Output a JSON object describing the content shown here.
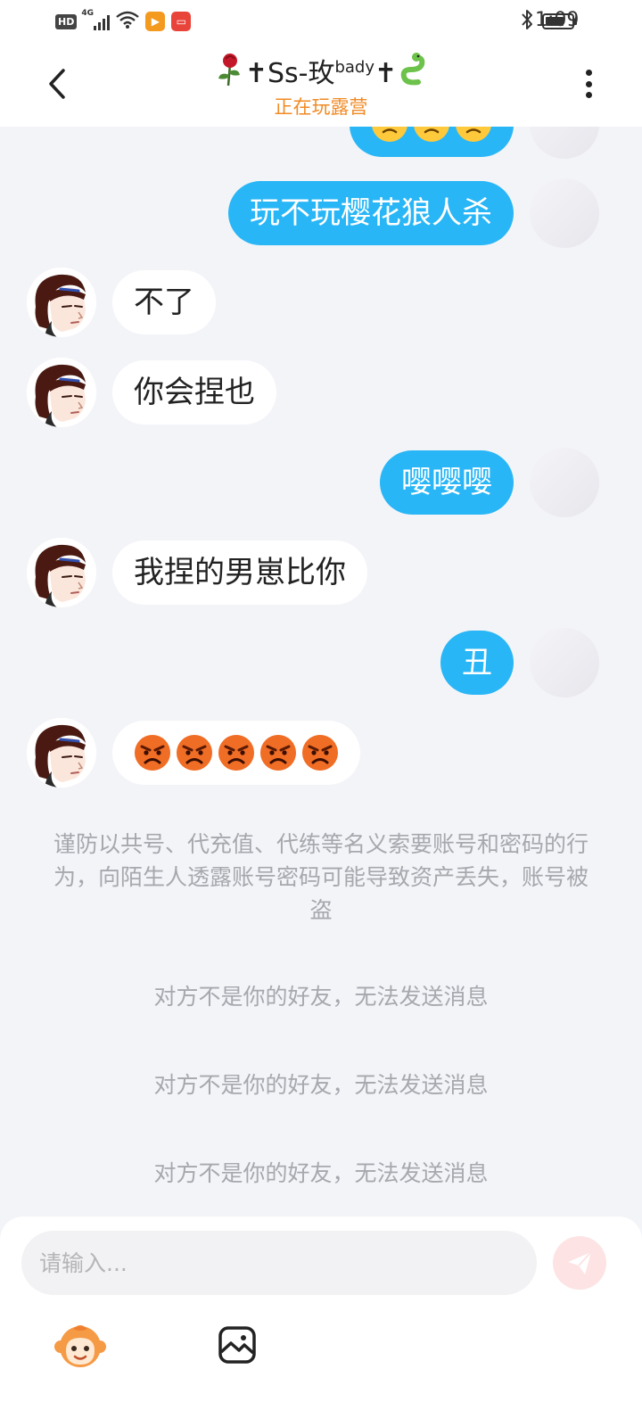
{
  "status_bar": {
    "hd": "HD",
    "network": "4G",
    "time": "1:09",
    "icons": [
      "hd-icon",
      "signal-icon",
      "wifi-icon",
      "video-app-icon",
      "reader-app-icon",
      "bluetooth-icon",
      "battery-icon"
    ]
  },
  "header": {
    "contact_name": "✝Ss-玫",
    "contact_name_sup": "bady",
    "contact_name_tail": "✝",
    "contact_status": "正在玩露营",
    "icons": [
      "back-icon",
      "rose-icon",
      "snake-icon",
      "more-icon"
    ]
  },
  "messages": [
    {
      "side": "out",
      "type": "emoji",
      "emoji": "sad-face",
      "count": 3
    },
    {
      "side": "out",
      "type": "text",
      "text": "玩不玩樱花狼人杀"
    },
    {
      "side": "in",
      "type": "text",
      "text": "不了"
    },
    {
      "side": "in",
      "type": "text",
      "text": "你会捏也"
    },
    {
      "side": "out",
      "type": "text",
      "text": "嘤嘤嘤"
    },
    {
      "side": "in",
      "type": "text",
      "text": "我捏的男崽比你"
    },
    {
      "side": "out",
      "type": "text",
      "text": "丑"
    },
    {
      "side": "in",
      "type": "emoji",
      "emoji": "angry-face",
      "count": 5
    }
  ],
  "notices": {
    "security": "谨防以共号、代充值、代练等名义索要账号和密码的行为，向陌生人透露账号密码可能导致资产丢失，账号被盗",
    "not_friend": "对方不是你的好友，无法发送消息"
  },
  "input": {
    "placeholder": "请输入..."
  },
  "colors": {
    "outgoing_bubble": "#29b6f6",
    "incoming_bubble": "#ffffff",
    "status_orange": "#f08a24",
    "background": "#f3f4f8",
    "send_button": "#fde3e3"
  }
}
